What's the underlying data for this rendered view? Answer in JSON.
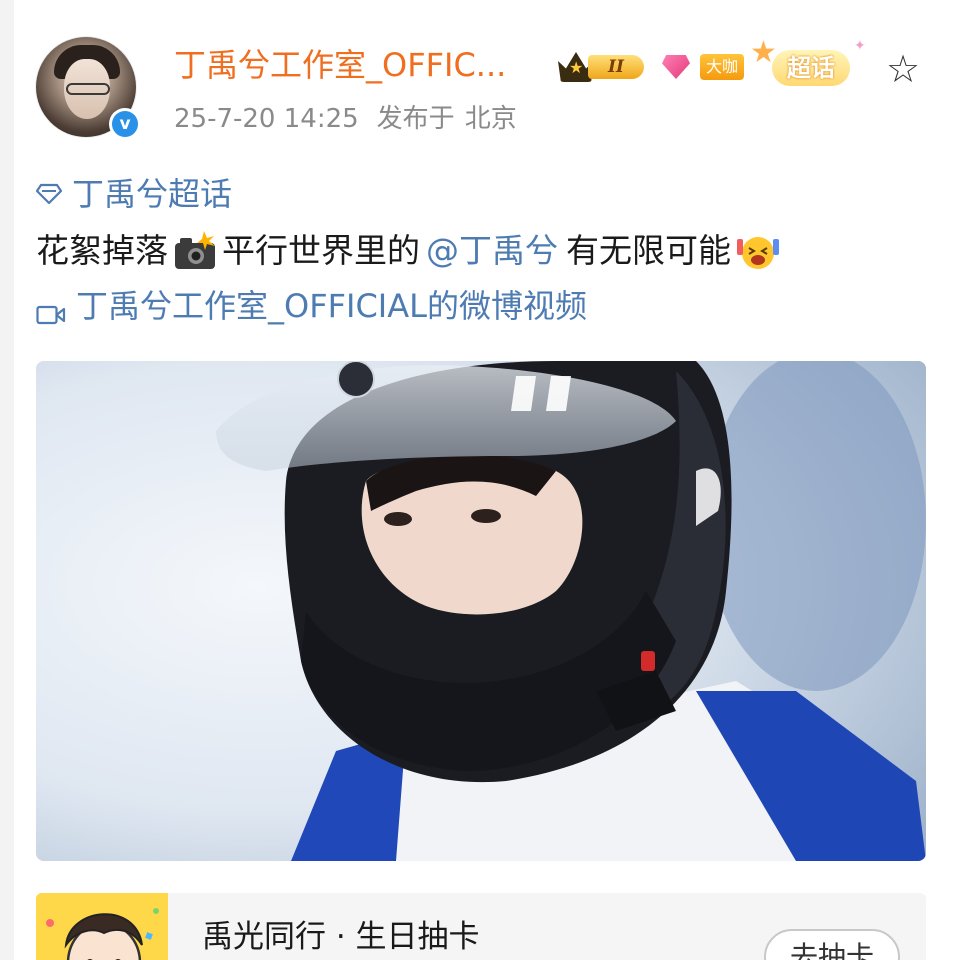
{
  "post": {
    "username": "丁禹兮工作室_OFFIC...",
    "timestamp": "25-7-20 14:25",
    "location_prefix": "发布于",
    "location": "北京",
    "verified_mark": "v",
    "badges": {
      "level_label": "II",
      "dk_label": "大咖",
      "chaohua_label": "超话"
    },
    "topic": "丁禹兮超话",
    "text_part1": "花絮掉落",
    "text_part2": "平行世界里的",
    "mention": "@丁禹兮",
    "text_part3": "有无限可能",
    "video_link": "丁禹兮工作室_OFFICIAL的微博视频",
    "icons": {
      "star": "star-outline-icon",
      "topic": "diamond-icon",
      "video": "video-camera-icon",
      "emoji_camera": "camera-flash-emoji",
      "emoji_crazy": "excited-face-emoji"
    }
  },
  "promo": {
    "title": "禹光同行 · 生日抽卡",
    "action_label": "去抽卡"
  },
  "colors": {
    "username": "#f06e1f",
    "link": "#4e7cb2",
    "meta": "#8a8a8a",
    "text": "#1a1a1a"
  }
}
